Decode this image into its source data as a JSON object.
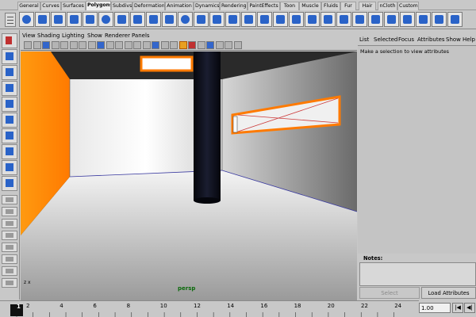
{
  "shelf": {
    "tabs": [
      "General",
      "Curves",
      "Surfaces",
      "Polygons",
      "Subdivs",
      "Deformation",
      "Animation",
      "Dynamics",
      "Rendering",
      "PaintEffects",
      "Toon",
      "Muscle",
      "Fluids",
      "Fur",
      "Hair",
      "nCloth",
      "Custom"
    ],
    "active_tab": "Polygons",
    "icons": [
      "sphere-icon",
      "cube-icon",
      "cylinder-icon",
      "cone-icon",
      "plane-icon",
      "torus-icon",
      "prism-icon",
      "pyramid-icon",
      "pipe-icon",
      "helix-icon",
      "soccer-ball-icon",
      "platonic-icon",
      "combine-icon",
      "separate-icon",
      "extract-icon",
      "boolean-union-icon",
      "boolean-difference-icon",
      "boolean-intersection-icon",
      "mirror-icon",
      "smooth-icon",
      "reduce-icon",
      "cleanup-icon",
      "triangulate-icon",
      "quadrangulate-icon",
      "fill-hole-icon",
      "make-hole-icon",
      "extrude-icon",
      "bridge-icon",
      "append-icon",
      "split-icon",
      "insert-edge-loop-icon",
      "offset-edge-loop-icon",
      "bevel-icon",
      "wedge-icon",
      "poke-icon",
      "duplicate-face-icon",
      "checker-icon",
      "uv-editor-icon"
    ]
  },
  "toolbox": {
    "tools": [
      "select-tool-icon",
      "lasso-tool-icon",
      "paint-select-tool-icon",
      "move-tool-icon",
      "rotate-tool-icon",
      "scale-tool-icon",
      "universal-manipulator-icon",
      "soft-modification-icon",
      "show-manipulator-icon",
      "last-tool-icon",
      "single-perspective-layout-icon",
      "four-view-layout-icon",
      "persp-outliner-layout-icon",
      "persp-graph-layout-icon",
      "hypershade-persp-layout-icon",
      "persp-graph-hypershade-layout-icon",
      "outliner-layout-icon",
      "render-view-layout-icon"
    ]
  },
  "panel": {
    "menu": [
      "View",
      "Shading",
      "Lighting",
      "Show",
      "Renderer",
      "Panels"
    ],
    "camera": "persp",
    "axis": "z x"
  },
  "attribute_editor": {
    "menu": [
      "List",
      "Selected",
      "Focus",
      "Attributes",
      "Show",
      "Help"
    ],
    "message": "Make a selection to view attributes",
    "notes_label": "Notes:",
    "select_label": "Select",
    "load_label": "Load Attributes"
  },
  "time_slider": {
    "current_frame_label": "1",
    "ticks": [
      "2",
      "4",
      "6",
      "8",
      "10",
      "12",
      "14",
      "16",
      "18",
      "20",
      "22",
      "24"
    ],
    "frame_field": "1.00"
  },
  "colors": {
    "orange_wall": "#ff8a00",
    "selection_highlight": "#ff7a00",
    "pillar": "#0d0f1a",
    "background": "#c8c8c8",
    "camera_label": "#0c6b0c"
  }
}
